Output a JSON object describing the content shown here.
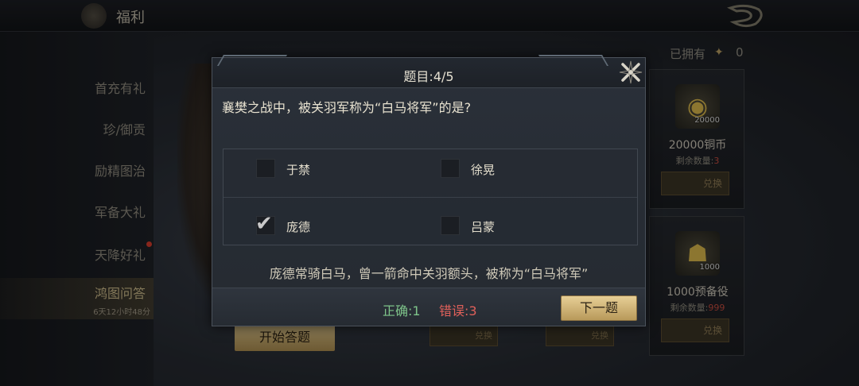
{
  "topbar": {
    "title": "福利"
  },
  "sidebar": {
    "items": [
      {
        "label": "首充有礼"
      },
      {
        "label": "珍/御贡"
      },
      {
        "label": "励精图治"
      },
      {
        "label": "军备大礼"
      },
      {
        "label": "天降好礼"
      },
      {
        "label": "鸿图问答",
        "sub": "6天12小时48分"
      }
    ]
  },
  "main": {
    "start_button": "开始答题",
    "owned_label": "已拥有",
    "owned_count": "0",
    "shop": [
      {
        "qty": "20000",
        "name": "20000铜币",
        "remain_label": "剩余数量:",
        "remain": "3",
        "button": "兑换"
      },
      {
        "qty": "1000",
        "name": "1000预备役",
        "remain_label": "剩余数量:",
        "remain": "999",
        "button": "兑换"
      }
    ],
    "under_buttons": [
      "兑换",
      "兑换"
    ]
  },
  "dialog": {
    "title": "题目:4/5",
    "question": "襄樊之战中，被关羽军称为“白马将军”的是?",
    "options": [
      {
        "label": "于禁",
        "checked": false
      },
      {
        "label": "徐晃",
        "checked": false
      },
      {
        "label": "庞德",
        "checked": true
      },
      {
        "label": "吕蒙",
        "checked": false
      }
    ],
    "check_mark": "✔",
    "explanation": "庞德常骑白马，曾一箭命中关羽额头，被称为“白马将军”",
    "correct_label": "正确:1",
    "wrong_label": "错误:3",
    "next_button": "下一题"
  },
  "colors": {
    "accent_gold": "#d9c28a",
    "correct": "#7ec48a",
    "wrong": "#e0605a",
    "alert": "#d23b2c"
  }
}
